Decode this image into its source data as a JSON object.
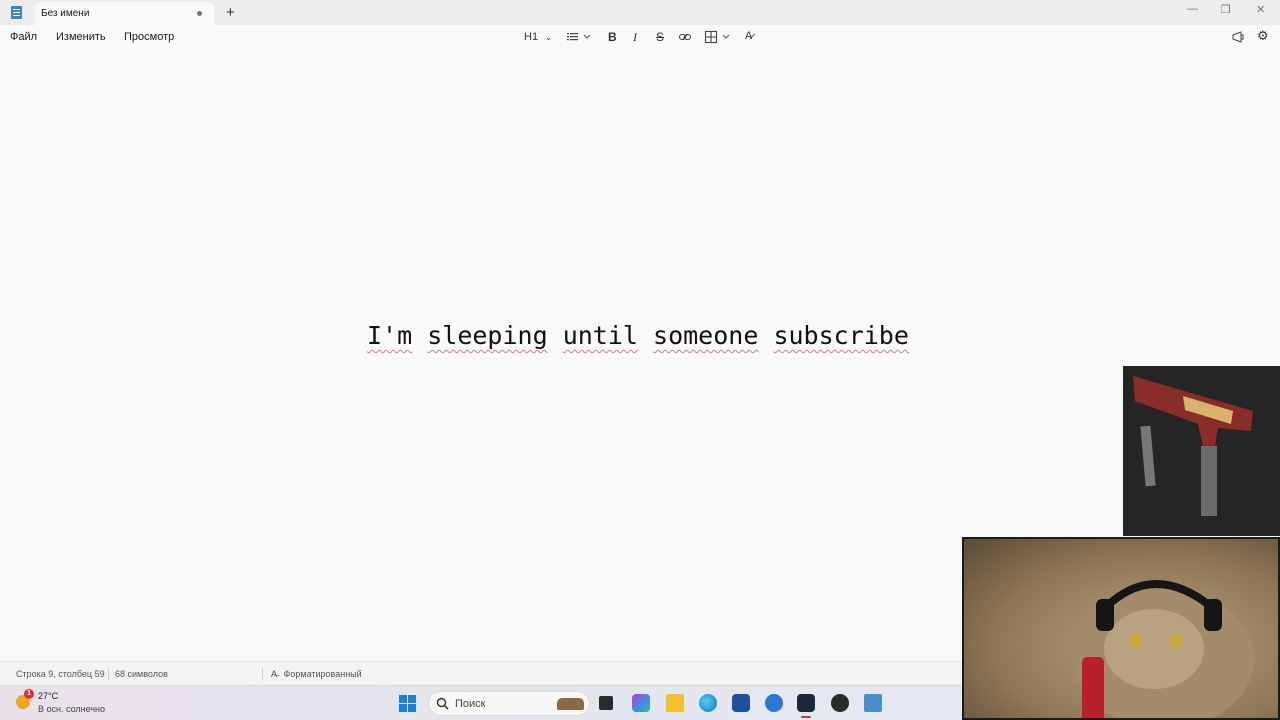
{
  "window": {
    "tab_title": "Без имени",
    "new_tab": "+",
    "controls": {
      "minimize": "—",
      "maximize": "❐",
      "close": "✕"
    }
  },
  "menu": {
    "file": "Файл",
    "edit": "Изменить",
    "view": "Просмотр"
  },
  "toolbar": {
    "heading": "H1"
  },
  "editor": {
    "words": [
      "I'm",
      "sleeping",
      "until",
      "someone",
      "subscribe"
    ]
  },
  "status": {
    "position": "Строка 9, столбец 59",
    "chars": "68 символов",
    "mode": "Форматированный"
  },
  "taskbar": {
    "weather_temp": "27°C",
    "weather_desc": "В осн. солнечно",
    "weather_badge": "1",
    "search_placeholder": "Поиск"
  },
  "colors": {
    "accent": "#1c7fd6",
    "spellcheck": "#d97b7b",
    "steam_active": "#c53b3b"
  }
}
